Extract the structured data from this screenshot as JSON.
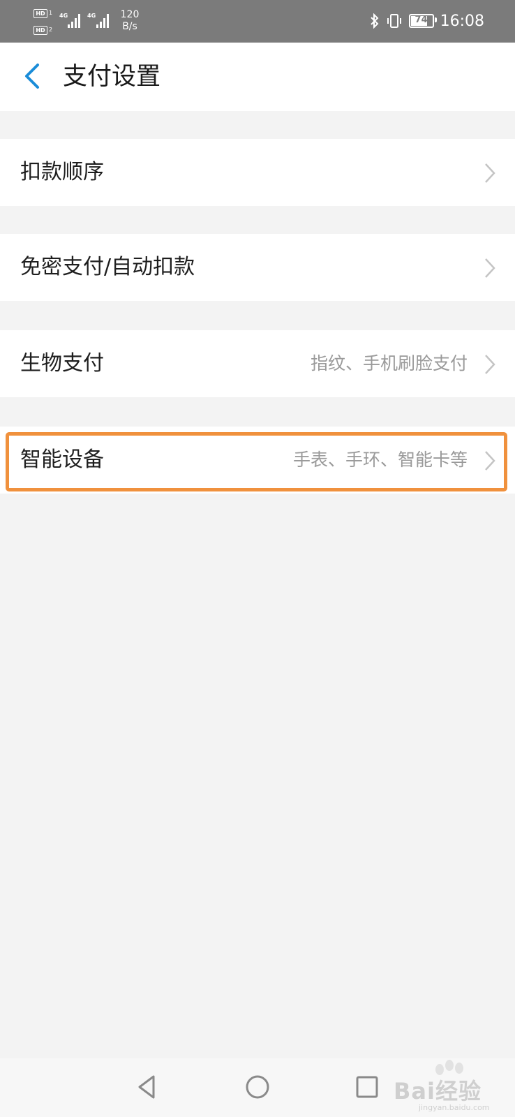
{
  "status_bar": {
    "hd1": "HD",
    "hd2": "HD",
    "sim1": "1",
    "sim2": "2",
    "network1": "4G",
    "network2": "4G",
    "speed_value": "120",
    "speed_unit": "B/s",
    "battery": "74",
    "time": "16:08"
  },
  "header": {
    "title": "支付设置"
  },
  "settings": [
    {
      "label": "扣款顺序",
      "value": ""
    },
    {
      "label": "免密支付/自动扣款",
      "value": ""
    },
    {
      "label": "生物支付",
      "value": "指纹、手机刷脸支付"
    },
    {
      "label": "智能设备",
      "value": "手表、手环、智能卡等"
    }
  ],
  "colors": {
    "accent": "#1a8cd8",
    "highlight": "#f0913d",
    "background": "#f3f3f3"
  },
  "watermark": {
    "text": "Bai经验",
    "sub": "jingyan.baidu.com"
  }
}
